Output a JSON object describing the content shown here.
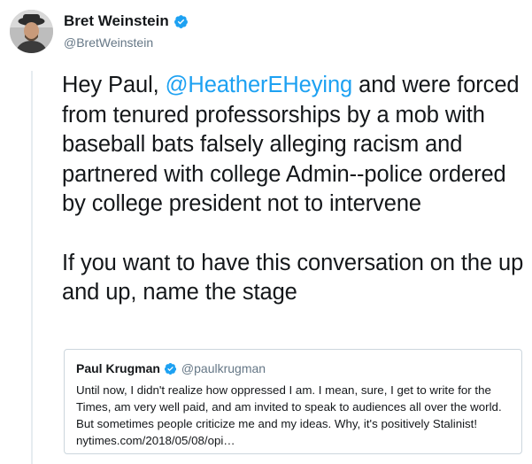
{
  "tweet": {
    "author": {
      "display_name": "Bret Weinstein",
      "handle": "@BretWeinstein",
      "verified": true
    },
    "text_part1": "Hey Paul, ",
    "mention": "@HeatherEHeying",
    "text_part2": " and were forced from tenured professorships by a mob with baseball bats falsely alleging racism and partnered with college Admin--police ordered by college president not to intervene",
    "text_paragraph2": "If you want to have this conversation on the up and up, name the stage"
  },
  "quoted_tweet": {
    "author": {
      "display_name": "Paul Krugman",
      "handle": "@paulkrugman",
      "verified": true
    },
    "text": "Until now, I didn't realize how oppressed I am. I mean, sure, I get to write for the Times, am very well paid, and am invited to speak to audiences all over the world. But sometimes people criticize me and my ideas. Why, it's positively Stalinist! nytimes.com/2018/05/08/opi…"
  },
  "colors": {
    "link": "#1da1f2",
    "secondary_text": "#657786",
    "verified_badge": "#1da1f2",
    "border": "#ccd6dd",
    "thread_line": "#e6ecf0"
  },
  "icons": {
    "verified": "verified-badge-icon",
    "avatar": "user-avatar"
  }
}
